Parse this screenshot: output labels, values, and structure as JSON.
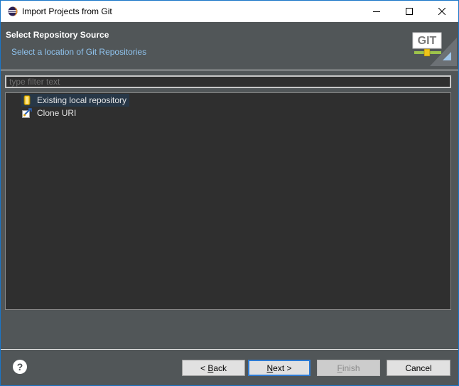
{
  "window": {
    "title": "Import Projects from Git"
  },
  "header": {
    "title": "Select Repository Source",
    "subtitle": "Select a location of Git Repositories",
    "logo_text": "GIT"
  },
  "filter": {
    "placeholder": "type filter text",
    "value": ""
  },
  "tree": {
    "items": [
      {
        "label": "Existing local repository",
        "icon": "repository-icon",
        "selected": true
      },
      {
        "label": "Clone URI",
        "icon": "clone-icon",
        "selected": false
      }
    ]
  },
  "buttons": {
    "back": {
      "prefix": "< ",
      "mnemonic": "B",
      "rest": "ack"
    },
    "next": {
      "mnemonic": "N",
      "rest": "ext",
      "suffix": " >"
    },
    "finish": {
      "mnemonic": "F",
      "rest": "inish"
    },
    "cancel": "Cancel"
  },
  "help": {
    "glyph": "?"
  },
  "colors": {
    "accent": "#1a76c8",
    "dialog_background": "#515658",
    "tree_background": "#2f2f2f",
    "selection": "#273747",
    "subtitle_text": "#8fc3ee"
  }
}
